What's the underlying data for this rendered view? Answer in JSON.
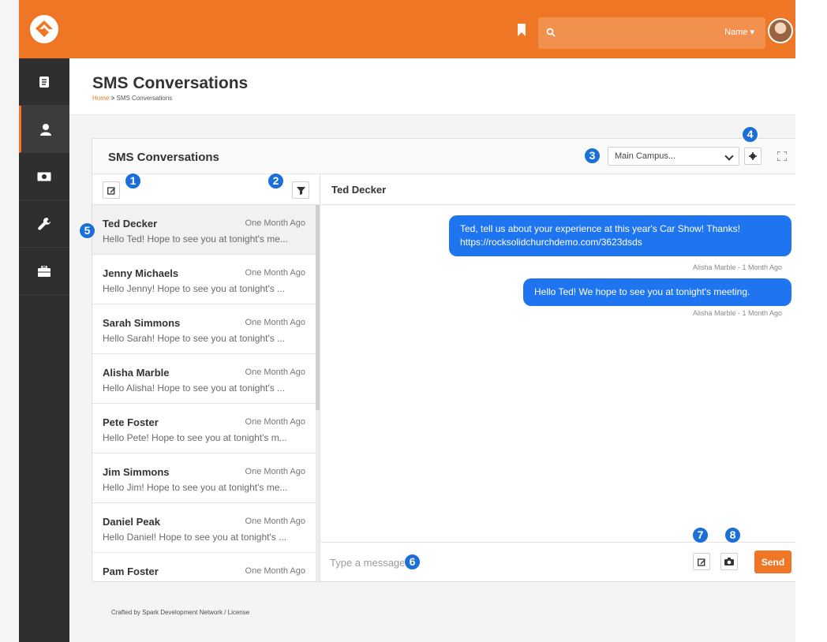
{
  "header": {
    "search_placeholder": "",
    "search_filter_label": "Name ▾",
    "avatar_caret": "⌄"
  },
  "page": {
    "title": "SMS Conversations",
    "breadcrumb_home": "Home",
    "breadcrumb_sep": ">",
    "breadcrumb_current": "SMS Conversations"
  },
  "panel": {
    "title": "SMS Conversations",
    "campus": "Main Campus..."
  },
  "conversation_list": [
    {
      "name": "Ted Decker",
      "time": "One Month Ago",
      "snippet": "Hello Ted! Hope to see you at tonight's me...",
      "active": true
    },
    {
      "name": "Jenny Michaels",
      "time": "One Month Ago",
      "snippet": "Hello Jenny! Hope to see you at tonight's ...",
      "active": false
    },
    {
      "name": "Sarah Simmons",
      "time": "One Month Ago",
      "snippet": "Hello Sarah! Hope to see you at tonight's ...",
      "active": false
    },
    {
      "name": "Alisha Marble",
      "time": "One Month Ago",
      "snippet": "Hello Alisha! Hope to see you at tonight's ...",
      "active": false
    },
    {
      "name": "Pete Foster",
      "time": "One Month Ago",
      "snippet": "Hello Pete! Hope to see you at tonight's m...",
      "active": false
    },
    {
      "name": "Jim Simmons",
      "time": "One Month Ago",
      "snippet": "Hello Jim! Hope to see you at tonight's me...",
      "active": false
    },
    {
      "name": "Daniel Peak",
      "time": "One Month Ago",
      "snippet": "Hello Daniel! Hope to see you at tonight's ...",
      "active": false
    },
    {
      "name": "Pam Foster",
      "time": "One Month Ago",
      "snippet": "",
      "active": false
    }
  ],
  "chat": {
    "recipient": "Ted Decker",
    "messages": [
      {
        "text_line1": "Ted, tell us about your experience at this year's Car Show! Thanks!",
        "text_line2": "https://rocksolidchurchdemo.com/3623dsds",
        "meta": "Alisha Marble - 1 Month Ago"
      },
      {
        "text_line1": "Hello Ted! We hope to see you at tonight's meeting.",
        "text_line2": "",
        "meta": "Alisha Marble - 1 Month Ago"
      }
    ],
    "input_placeholder": "Type a message",
    "send_label": "Send"
  },
  "callouts": [
    "1",
    "2",
    "3",
    "4",
    "5",
    "6",
    "7",
    "8"
  ],
  "footer": "Crafted by Spark Development Network / License",
  "colors": {
    "brand_orange": "#ee7625",
    "bubble_blue": "#1f74f0",
    "callout_blue": "#1a70d8",
    "sidebar_dark": "#2f2f2f"
  },
  "icons": {
    "logo": "rock-logo",
    "bookmark": "bookmark-icon",
    "search": "search-icon",
    "sidebar": [
      "book-icon",
      "user-icon",
      "money-icon",
      "wrench-icon",
      "briefcase-icon"
    ],
    "compose": "compose-icon",
    "filter": "filter-icon",
    "settings": "gear-icon",
    "fullscreen": "fullscreen-icon",
    "camera": "camera-icon"
  }
}
